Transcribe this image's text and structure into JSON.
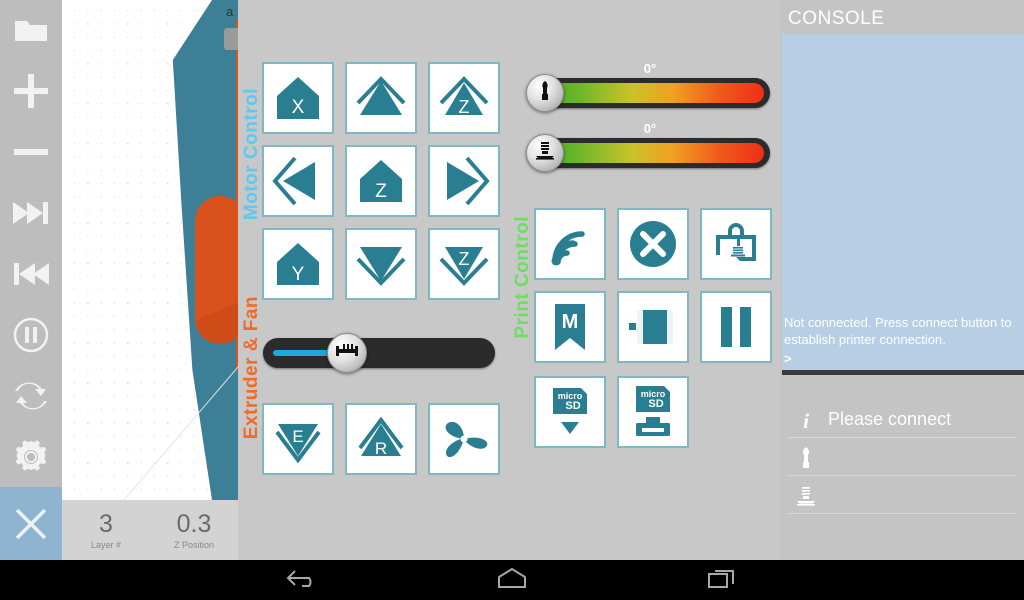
{
  "app": {
    "title": "3D Printer Control",
    "accent_teal": "#2a7e92",
    "accent_orange": "#d9511c",
    "accent_bed_blue": "#3d7f96"
  },
  "left_toolbar": {
    "items": [
      {
        "name": "folder-icon",
        "label": "Open File"
      },
      {
        "name": "plus-icon",
        "label": "Zoom In"
      },
      {
        "name": "minus-icon",
        "label": "Zoom Out"
      },
      {
        "name": "fast-forward-icon",
        "label": "Next Layer"
      },
      {
        "name": "rewind-icon",
        "label": "Previous Layer"
      },
      {
        "name": "pause-circle-icon",
        "label": "Pause Playback"
      },
      {
        "name": "refresh-icon",
        "label": "Reload"
      },
      {
        "name": "gear-icon",
        "label": "Settings"
      },
      {
        "name": "close-x-icon",
        "label": "Close"
      }
    ]
  },
  "viewer": {
    "overlay_text": "a",
    "print_head_icon": "printer-icon",
    "status": {
      "layer": {
        "value": "3",
        "label": "Layer #"
      },
      "z_position": {
        "value": "0.3",
        "label": "Z Position"
      }
    }
  },
  "panel": {
    "section_labels": {
      "motor_control": "Motor Control",
      "extruder_fan": "Extruder & Fan",
      "print_control": "Print Control"
    },
    "motor_buttons": [
      {
        "name": "home-x-button",
        "icon": "home-x-icon",
        "label": "X"
      },
      {
        "name": "move-y-plus-button",
        "icon": "chevron-up-icon",
        "label": "Y+"
      },
      {
        "name": "move-z-up-button",
        "icon": "chevron-up-z-icon",
        "label": "Z"
      },
      {
        "name": "move-x-minus-button",
        "icon": "chevron-left-icon",
        "label": "X-"
      },
      {
        "name": "home-z-button",
        "icon": "home-z-icon",
        "label": "Z"
      },
      {
        "name": "move-x-plus-button",
        "icon": "chevron-right-icon",
        "label": "X+"
      },
      {
        "name": "home-y-button",
        "icon": "home-y-icon",
        "label": "Y"
      },
      {
        "name": "move-y-minus-button",
        "icon": "chevron-down-icon",
        "label": "Y-"
      },
      {
        "name": "move-z-down-button",
        "icon": "chevron-down-z-icon",
        "label": "Z"
      }
    ],
    "extruder_buttons": [
      {
        "name": "extrude-button",
        "icon": "extrude-e-icon",
        "label": "E"
      },
      {
        "name": "retract-button",
        "icon": "retract-r-icon",
        "label": "R"
      },
      {
        "name": "fan-button",
        "icon": "fan-icon",
        "label": "Fan"
      }
    ],
    "extruder_slider": {
      "name": "extruder-speed-slider",
      "value": "27",
      "knob_icon": "flow-icon"
    },
    "temperatures": [
      {
        "name": "extruder-temp-slider",
        "value": "0°",
        "knob_icon": "nozzle-icon",
        "position": 0
      },
      {
        "name": "bed-temp-slider",
        "value": "0°",
        "knob_icon": "heated-bed-icon",
        "position": 0
      }
    ],
    "print_buttons": [
      {
        "name": "connect-button",
        "icon": "wifi-icon",
        "label": "Connect"
      },
      {
        "name": "stop-print-button",
        "icon": "cancel-x-icon",
        "label": "Stop"
      },
      {
        "name": "print-preview-button",
        "icon": "print-job-icon",
        "label": "Print"
      },
      {
        "name": "macro-button",
        "icon": "macro-m-bookmark-icon",
        "label": "M"
      },
      {
        "name": "eject-button",
        "icon": "eject-panel-icon",
        "label": "Eject"
      },
      {
        "name": "pause-print-button",
        "icon": "pause-bars-icon",
        "label": "Pause"
      },
      {
        "name": "sd-download-button",
        "icon": "microsd-down-icon",
        "label": "SD Load"
      },
      {
        "name": "sd-print-button",
        "icon": "microsd-print-icon",
        "label": "SD Print"
      }
    ]
  },
  "console": {
    "title": "CONSOLE",
    "message": "Not connected. Press connect button to establish printer connection.",
    "prompt": ">",
    "info_rows": [
      {
        "name": "status-row",
        "icon": "info-icon",
        "text": "Please connect"
      },
      {
        "name": "extruder-temp-row",
        "icon": "nozzle-icon",
        "text": ""
      },
      {
        "name": "bed-temp-row",
        "icon": "heated-bed-icon",
        "text": ""
      }
    ],
    "connection_buttons": [
      {
        "name": "wifi-connect-button",
        "icon": "wifi-icon"
      },
      {
        "name": "printer-connect-button",
        "icon": "print-job-icon"
      }
    ]
  },
  "android_nav": {
    "buttons": [
      {
        "name": "nav-back-button",
        "icon": "back-arrow-icon"
      },
      {
        "name": "nav-home-button",
        "icon": "home-pentagon-icon"
      },
      {
        "name": "nav-recents-button",
        "icon": "recents-squares-icon"
      }
    ]
  }
}
